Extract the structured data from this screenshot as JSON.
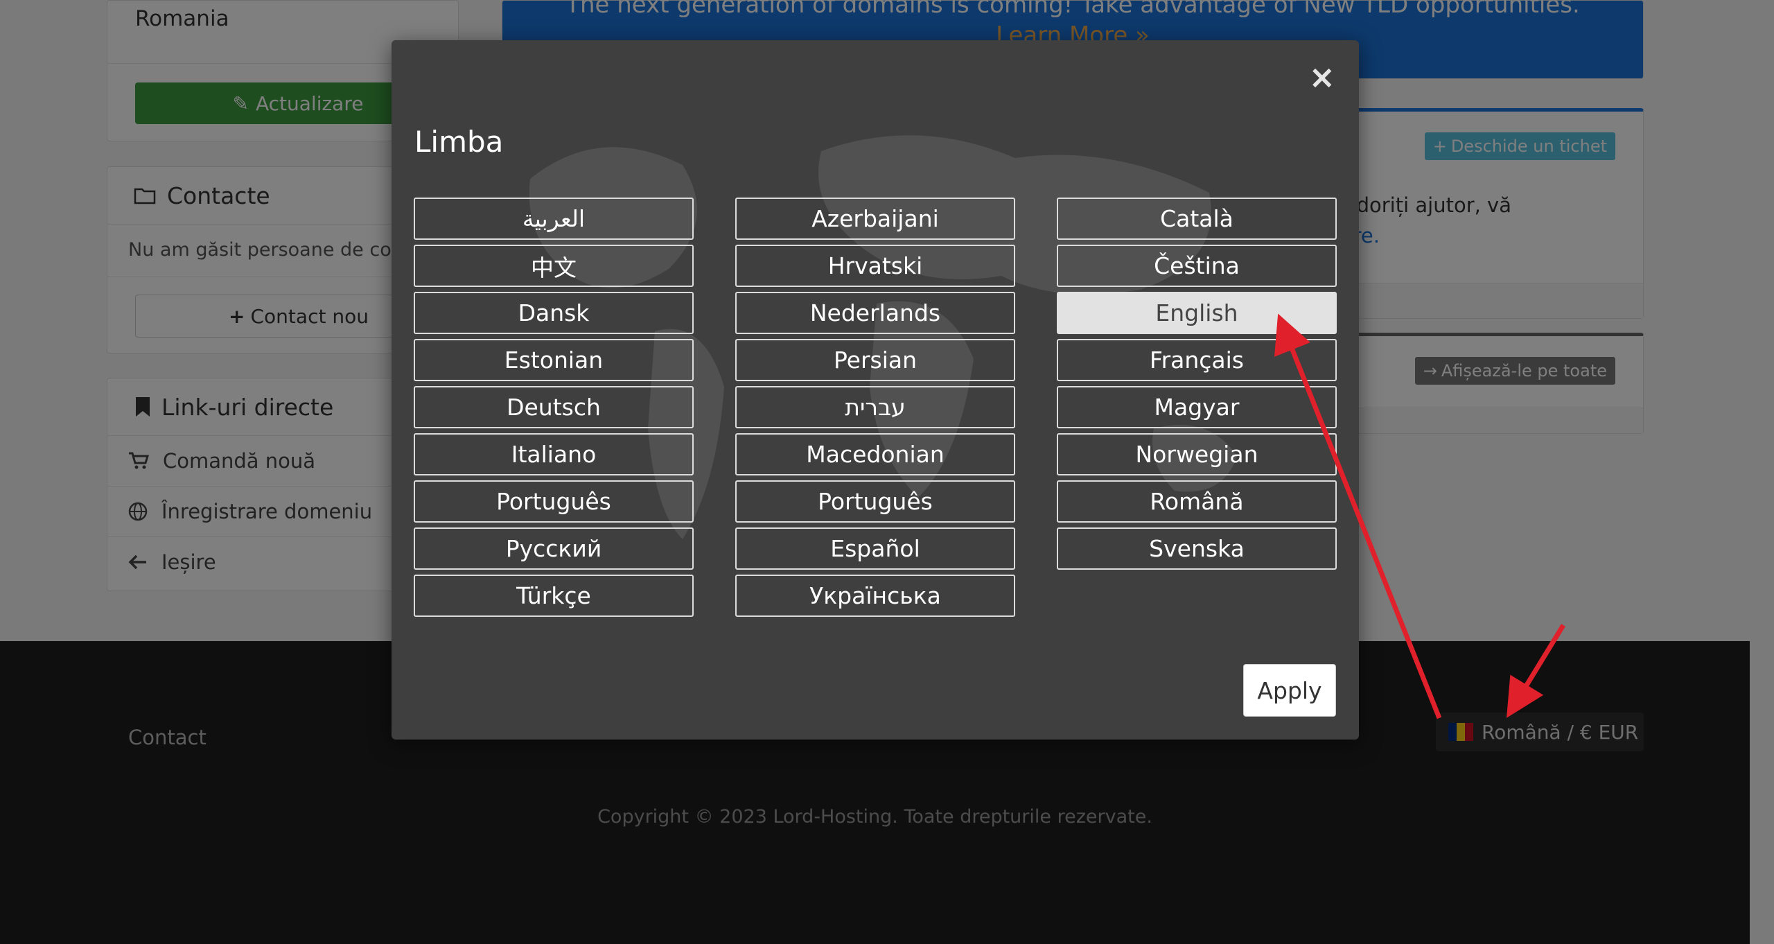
{
  "sidebar": {
    "country_value": "Romania",
    "update_button": "Actualizare",
    "contacts_title": "Contacte",
    "contacts_empty": "Nu am găsit persoane de contact",
    "new_contact_button": "Contact nou",
    "links_title": "Link-uri directe",
    "links": [
      {
        "label": "Comandă nouă",
        "icon": "cart-icon"
      },
      {
        "label": "Înregistrare domeniu",
        "icon": "globe-icon"
      },
      {
        "label": "Ieșire",
        "icon": "arrow-left-icon"
      }
    ]
  },
  "main": {
    "banner_line1": "The next generation of domains is coming! Take advantage of New TLD opportunities.",
    "banner_line2": "Learn More »",
    "open_ticket_button": "Deschide un tichet",
    "ticket_text": "e. Dacă doriți ajutor, vă",
    "ticket_link": "re.",
    "show_all_button": "Afișează-le pe toate"
  },
  "footer": {
    "contact_link": "Contact",
    "language_currency": "Română / € EUR",
    "copyright": "Copyright © 2023 Lord-Hosting. Toate drepturile rezervate."
  },
  "modal": {
    "title": "Limba",
    "close": "×",
    "apply_button": "Apply",
    "selected_language": "English",
    "languages": [
      "العربية",
      "Azerbaijani",
      "Català",
      "中文",
      "Hrvatski",
      "Čeština",
      "Dansk",
      "Nederlands",
      "English",
      "Estonian",
      "Persian",
      "Français",
      "Deutsch",
      "עברית",
      "Magyar",
      "Italiano",
      "Macedonian",
      "Norwegian",
      "Português",
      "Português",
      "Română",
      "Русский",
      "Español",
      "Svenska",
      "Türkçe",
      "Українська"
    ]
  },
  "colors": {
    "accent_blue": "#1a72d9",
    "green": "#3c9a3f",
    "annotation_arrow": "#e0202a",
    "modal_bg": "#3f3f3f"
  }
}
